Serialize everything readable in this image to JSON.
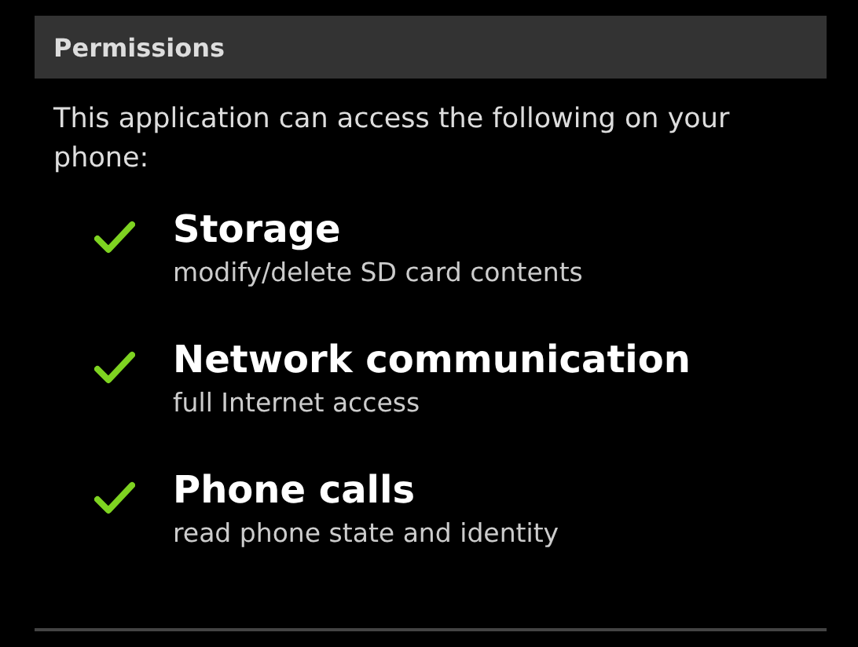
{
  "header": {
    "title": "Permissions"
  },
  "intro": "This application can access the following on your phone:",
  "permissions": [
    {
      "title": "Storage",
      "detail": "modify/delete SD card contents"
    },
    {
      "title": "Network communication",
      "detail": "full Internet access"
    },
    {
      "title": "Phone calls",
      "detail": "read phone state and identity"
    }
  ]
}
